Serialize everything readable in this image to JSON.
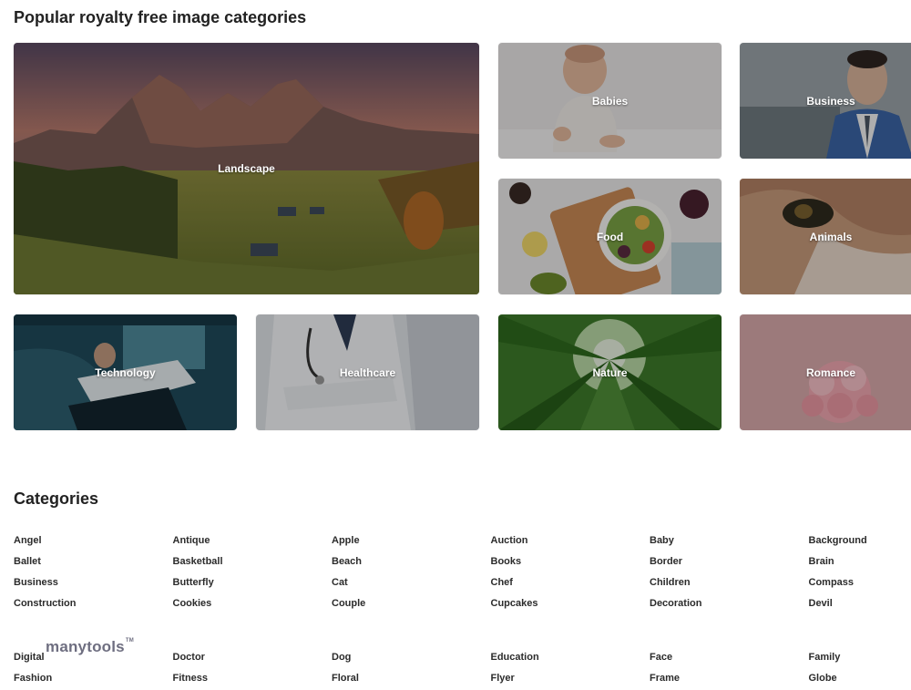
{
  "popular": {
    "title": "Popular royalty free image categories",
    "tiles": [
      {
        "label": "Landscape"
      },
      {
        "label": "Babies"
      },
      {
        "label": "Business"
      },
      {
        "label": "Food"
      },
      {
        "label": "Animals"
      },
      {
        "label": "Technology"
      },
      {
        "label": "Healthcare"
      },
      {
        "label": "Nature"
      },
      {
        "label": "Romance"
      }
    ]
  },
  "categories": {
    "title": "Categories",
    "group_a": [
      "Angel",
      "Antique",
      "Apple",
      "Auction",
      "Baby",
      "Background",
      "Ballet",
      "Basketball",
      "Beach",
      "Books",
      "Border",
      "Brain",
      "Business",
      "Butterfly",
      "Cat",
      "Chef",
      "Children",
      "Compass",
      "Construction",
      "Cookies",
      "Couple",
      "Cupcakes",
      "Decoration",
      "Devil"
    ],
    "group_b": [
      "Digital",
      "Doctor",
      "Dog",
      "Education",
      "Face",
      "Family",
      "Fashion",
      "Fitness",
      "Floral",
      "Flyer",
      "Frame",
      "Globe"
    ]
  },
  "watermark": {
    "brand": "manytools",
    "tm": "TM"
  }
}
